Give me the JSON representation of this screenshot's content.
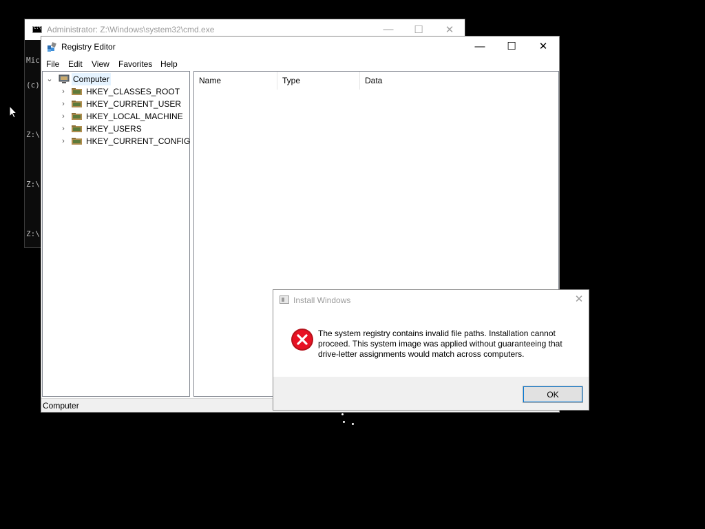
{
  "cmd": {
    "title": "Administrator: Z:\\Windows\\system32\\cmd.exe",
    "output_lines": [
      "Mic",
      "(c)",
      "",
      "Z:\\",
      "",
      "Z:\\",
      "",
      "Z:\\"
    ],
    "controls": {
      "minimize": "—",
      "maximize": "☐",
      "close": "✕"
    }
  },
  "regedit": {
    "title": "Registry Editor",
    "controls": {
      "minimize": "—",
      "maximize": "☐",
      "close": "✕"
    },
    "menu": [
      "File",
      "Edit",
      "View",
      "Favorites",
      "Help"
    ],
    "tree": {
      "root": {
        "label": "Computer",
        "expander": "⌄"
      },
      "children": [
        {
          "label": "HKEY_CLASSES_ROOT",
          "expander": "›"
        },
        {
          "label": "HKEY_CURRENT_USER",
          "expander": "›"
        },
        {
          "label": "HKEY_LOCAL_MACHINE",
          "expander": "›"
        },
        {
          "label": "HKEY_USERS",
          "expander": "›"
        },
        {
          "label": "HKEY_CURRENT_CONFIG",
          "expander": "›"
        }
      ]
    },
    "columns": [
      "Name",
      "Type",
      "Data"
    ],
    "status": "Computer"
  },
  "dialog": {
    "title": "Install Windows",
    "close": "✕",
    "message": "The system registry contains invalid file paths. Installation cannot proceed. This system image was applied without guaranteeing that drive-letter assignments would match across computers.",
    "ok_label": "OK"
  },
  "colors": {
    "desktop": "#000000",
    "selection": "#e5f3ff",
    "error_red": "#e81123",
    "focus_blue": "#0078d7"
  }
}
